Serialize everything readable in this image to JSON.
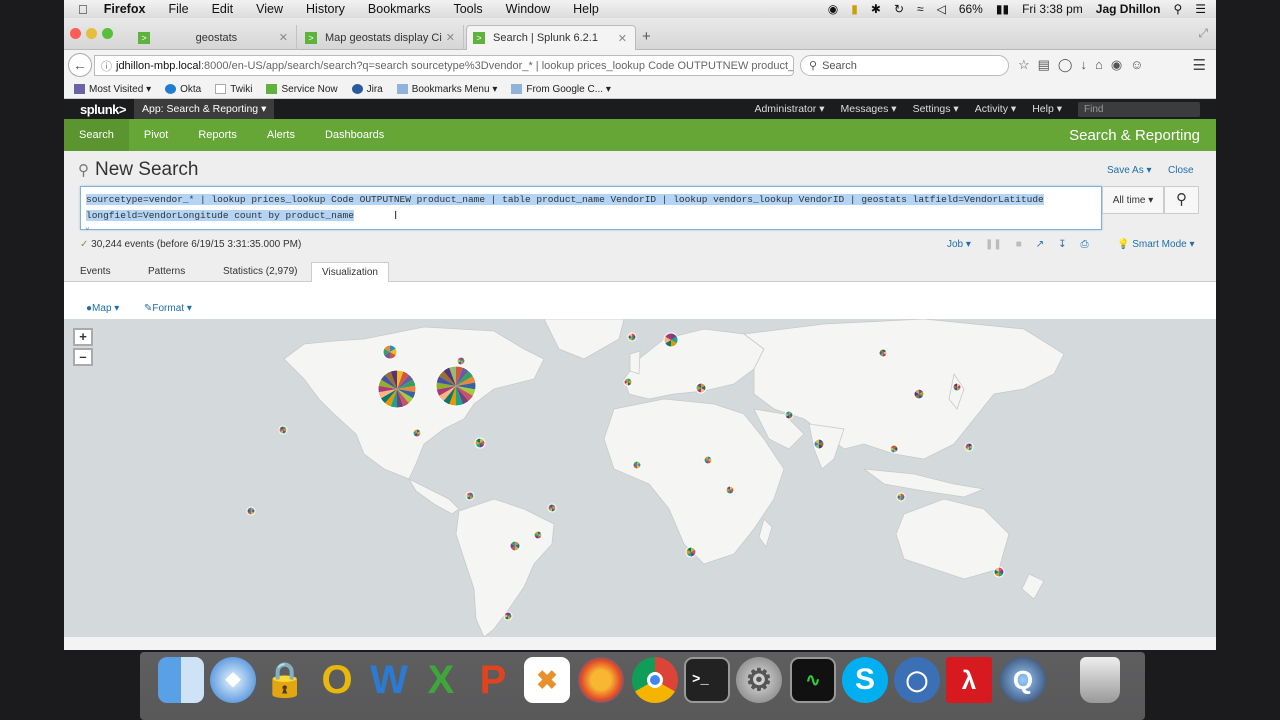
{
  "macbar": {
    "app_name": "Firefox",
    "menus": [
      "File",
      "Edit",
      "View",
      "History",
      "Bookmarks",
      "Tools",
      "Window",
      "Help"
    ],
    "battery": "66%",
    "clock": "Fri 3:38 pm",
    "user": "Jag Dhillon"
  },
  "browser": {
    "tabs": [
      {
        "label": "geostats"
      },
      {
        "label": "Map geostats display City ..."
      },
      {
        "label": "Search | Splunk 6.2.1"
      }
    ],
    "url_host": "jdhillon-mbp.local",
    "url_rest": ":8000/en-US/app/search/search?q=search sourcetype%3Dvendor_* | lookup prices_lookup Code OUTPUTNEW product_",
    "search_placeholder": "Search",
    "bookmarks": [
      "Most Visited",
      "Okta",
      "Twiki",
      "Service Now",
      "Jira",
      "Bookmarks Menu",
      "From Google C..."
    ]
  },
  "splunk": {
    "logo": "splunk>",
    "app_menu": "App: Search & Reporting",
    "top_menus": [
      "Administrator",
      "Messages",
      "Settings",
      "Activity",
      "Help"
    ],
    "find_placeholder": "Find",
    "nav": [
      "Search",
      "Pivot",
      "Reports",
      "Alerts",
      "Dashboards"
    ],
    "app_title": "Search & Reporting",
    "page_title": "New Search",
    "save_as": "Save As",
    "close": "Close",
    "query_line1": "sourcetype=vendor_* | lookup prices_lookup Code OUTPUTNEW product_name | table product_name VendorID | lookup vendors_lookup VendorID | geostats latfield=VendorLatitude",
    "query_line2": "longfield=VendorLongitude count by product_name",
    "time_range": "All time",
    "status": "30,244 events (before 6/19/15 3:31:35.000 PM)",
    "job": "Job",
    "smart_mode": "Smart Mode",
    "result_tabs": [
      "Events",
      "Patterns",
      "Statistics (2,979)",
      "Visualization"
    ],
    "map_label": "Map",
    "format_label": "Format"
  },
  "pie_colors": [
    "#1e93c6",
    "#f2b827",
    "#d6563c",
    "#6a5c9e",
    "#31a35f",
    "#ed8440",
    "#3863a0",
    "#a2cc3e",
    "#cc5068",
    "#73427f",
    "#11a88b",
    "#ea9600",
    "#0e776d",
    "#ffb380",
    "#aa3977",
    "#91af27",
    "#4453aa",
    "#99712b",
    "#553577",
    "#97bc71"
  ]
}
